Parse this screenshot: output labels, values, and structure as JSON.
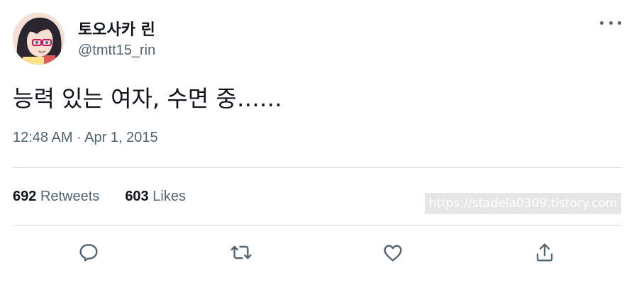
{
  "author": {
    "display_name": "토오사카 린",
    "handle": "@tmtt15_rin"
  },
  "tweet": {
    "text": "능력 있는 여자, 수면 중……",
    "timestamp": "12:48 AM · Apr 1, 2015"
  },
  "stats": {
    "retweets_count": "692",
    "retweets_label": "Retweets",
    "likes_count": "603",
    "likes_label": "Likes"
  },
  "watermark": "https://stadela0309.tistory.com",
  "icons": {
    "more": "more-options-icon",
    "reply": "reply-icon",
    "retweet": "retweet-icon",
    "like": "like-icon",
    "share": "share-icon"
  },
  "colors": {
    "text_primary": "#0f1419",
    "text_secondary": "#536471",
    "divider": "#cfd9de"
  }
}
